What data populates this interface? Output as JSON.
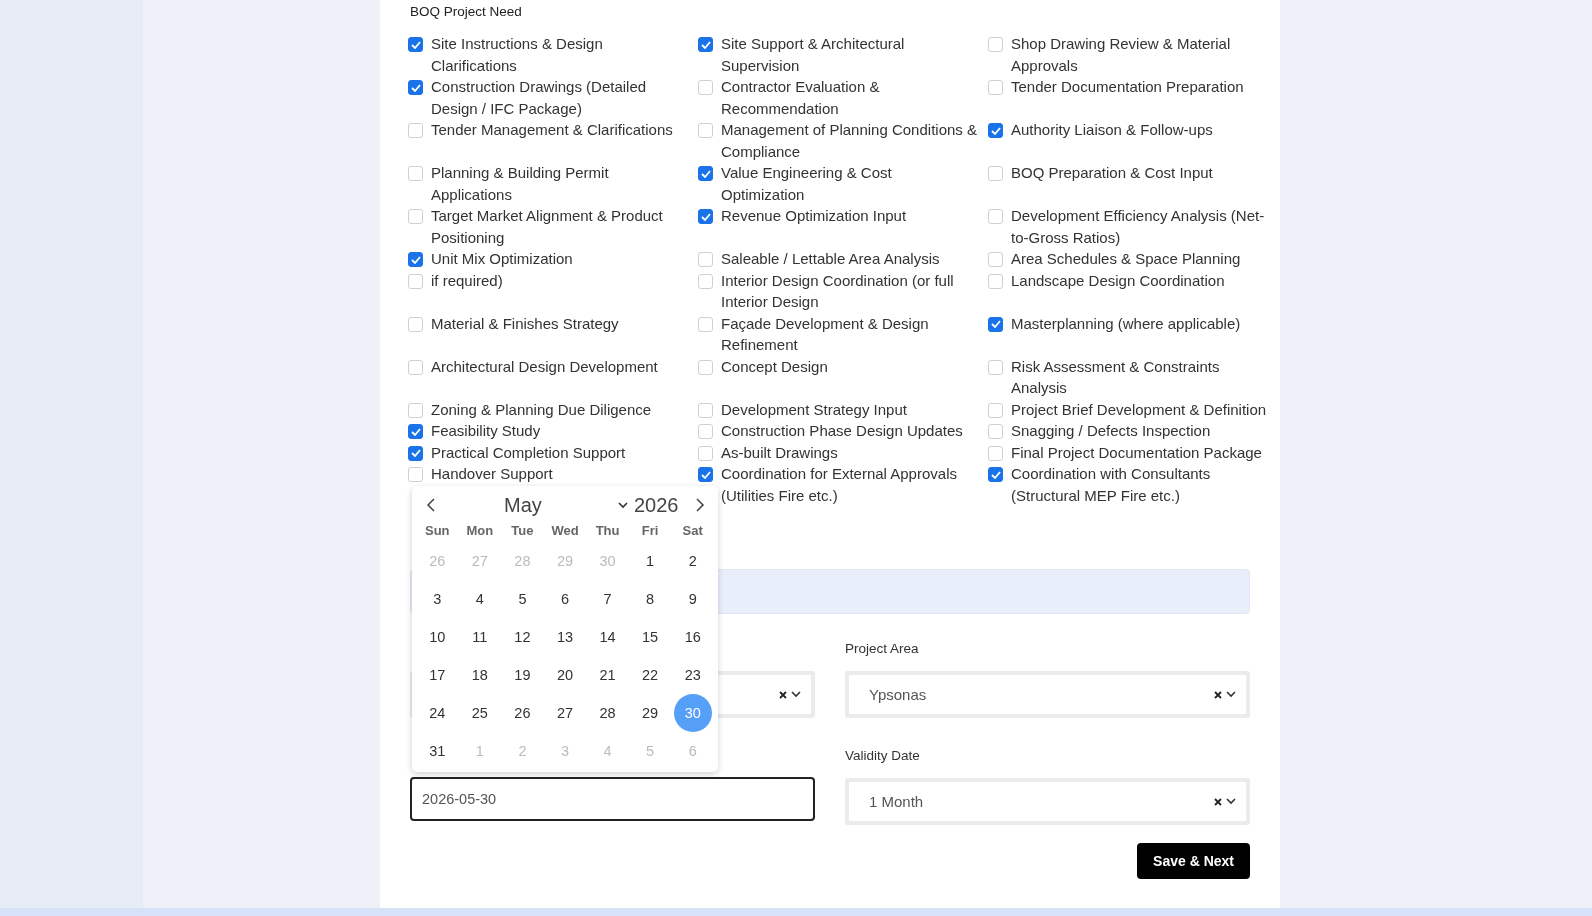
{
  "section": {
    "title": "BOQ Project Need",
    "options": [
      {
        "label": "Site Instructions & Design Clarifications",
        "checked": true
      },
      {
        "label": "Site Support & Architectural Supervision",
        "checked": true
      },
      {
        "label": "Shop Drawing Review & Material Approvals",
        "checked": false
      },
      {
        "label": "Construction Drawings (Detailed Design / IFC Package)",
        "checked": true
      },
      {
        "label": "Contractor Evaluation & Recommendation",
        "checked": false
      },
      {
        "label": "Tender Documentation Preparation",
        "checked": false
      },
      {
        "label": "Tender Management & Clarifications",
        "checked": false
      },
      {
        "label": "Management of Planning Conditions & Compliance",
        "checked": false
      },
      {
        "label": "Authority Liaison & Follow-ups",
        "checked": true
      },
      {
        "label": "Planning & Building Permit Applications",
        "checked": false
      },
      {
        "label": "Value Engineering & Cost Optimization",
        "checked": true
      },
      {
        "label": "BOQ Preparation & Cost Input",
        "checked": false
      },
      {
        "label": "Target Market Alignment & Product Positioning",
        "checked": false
      },
      {
        "label": "Revenue Optimization Input",
        "checked": true
      },
      {
        "label": "Development Efficiency Analysis (Net-to-Gross Ratios)",
        "checked": false
      },
      {
        "label": "Unit Mix Optimization",
        "checked": true
      },
      {
        "label": "Saleable / Lettable Area Analysis",
        "checked": false
      },
      {
        "label": "Area Schedules & Space Planning",
        "checked": false
      },
      {
        "label": "if required)",
        "checked": false
      },
      {
        "label": "Interior Design Coordination (or full Interior Design",
        "checked": false
      },
      {
        "label": "Landscape Design Coordination",
        "checked": false
      },
      {
        "label": "Material & Finishes Strategy",
        "checked": false
      },
      {
        "label": "Façade Development & Design Refinement",
        "checked": false
      },
      {
        "label": "Masterplanning (where applicable)",
        "checked": true
      },
      {
        "label": "Architectural Design Development",
        "checked": false
      },
      {
        "label": "Concept Design",
        "checked": false
      },
      {
        "label": "Risk Assessment & Constraints Analysis",
        "checked": false
      },
      {
        "label": "Zoning & Planning Due Diligence",
        "checked": false
      },
      {
        "label": "Development Strategy Input",
        "checked": false
      },
      {
        "label": "Project Brief Development & Definition",
        "checked": false
      },
      {
        "label": "Feasibility Study",
        "checked": true
      },
      {
        "label": "Construction Phase Design Updates",
        "checked": false
      },
      {
        "label": "Snagging / Defects Inspection",
        "checked": false
      },
      {
        "label": "Practical Completion Support",
        "checked": true
      },
      {
        "label": "As-built Drawings",
        "checked": false
      },
      {
        "label": "Final Project Documentation Package",
        "checked": false
      },
      {
        "label": "Handover Support",
        "checked": false
      },
      {
        "label": "Coordination for External Approvals (Utilities Fire etc.)",
        "checked": true
      },
      {
        "label": "Coordination with Consultants (Structural MEP Fire etc.)",
        "checked": true
      }
    ]
  },
  "fields": [
    {
      "kind": "select"
    },
    {
      "kind": "select",
      "label": "Project Area",
      "value": "Ypsonas"
    },
    {
      "kind": "date",
      "value": "2026-05-30",
      "focused": true
    },
    {
      "kind": "select",
      "label": "Validity Date",
      "value": "1 Month"
    }
  ],
  "datepicker": {
    "month": "May",
    "year": "2026",
    "weekdays": [
      "Sun",
      "Mon",
      "Tue",
      "Wed",
      "Thu",
      "Fri",
      "Sat"
    ],
    "days": [
      {
        "label": "26",
        "muted": true,
        "selected": false
      },
      {
        "label": "27",
        "muted": true,
        "selected": false
      },
      {
        "label": "28",
        "muted": true,
        "selected": false
      },
      {
        "label": "29",
        "muted": true,
        "selected": false
      },
      {
        "label": "30",
        "muted": true,
        "selected": false
      },
      {
        "label": "1",
        "muted": false,
        "selected": false
      },
      {
        "label": "2",
        "muted": false,
        "selected": false
      },
      {
        "label": "3",
        "muted": false,
        "selected": false
      },
      {
        "label": "4",
        "muted": false,
        "selected": false
      },
      {
        "label": "5",
        "muted": false,
        "selected": false
      },
      {
        "label": "6",
        "muted": false,
        "selected": false
      },
      {
        "label": "7",
        "muted": false,
        "selected": false
      },
      {
        "label": "8",
        "muted": false,
        "selected": false
      },
      {
        "label": "9",
        "muted": false,
        "selected": false
      },
      {
        "label": "10",
        "muted": false,
        "selected": false
      },
      {
        "label": "11",
        "muted": false,
        "selected": false
      },
      {
        "label": "12",
        "muted": false,
        "selected": false
      },
      {
        "label": "13",
        "muted": false,
        "selected": false
      },
      {
        "label": "14",
        "muted": false,
        "selected": false
      },
      {
        "label": "15",
        "muted": false,
        "selected": false
      },
      {
        "label": "16",
        "muted": false,
        "selected": false
      },
      {
        "label": "17",
        "muted": false,
        "selected": false
      },
      {
        "label": "18",
        "muted": false,
        "selected": false
      },
      {
        "label": "19",
        "muted": false,
        "selected": false
      },
      {
        "label": "20",
        "muted": false,
        "selected": false
      },
      {
        "label": "21",
        "muted": false,
        "selected": false
      },
      {
        "label": "22",
        "muted": false,
        "selected": false
      },
      {
        "label": "23",
        "muted": false,
        "selected": false
      },
      {
        "label": "24",
        "muted": false,
        "selected": false
      },
      {
        "label": "25",
        "muted": false,
        "selected": false
      },
      {
        "label": "26",
        "muted": false,
        "selected": false
      },
      {
        "label": "27",
        "muted": false,
        "selected": false
      },
      {
        "label": "28",
        "muted": false,
        "selected": false
      },
      {
        "label": "29",
        "muted": false,
        "selected": false
      },
      {
        "label": "30",
        "muted": false,
        "selected": true
      },
      {
        "label": "31",
        "muted": false,
        "selected": false
      },
      {
        "label": "1",
        "muted": true,
        "selected": false
      },
      {
        "label": "2",
        "muted": true,
        "selected": false
      },
      {
        "label": "3",
        "muted": true,
        "selected": false
      },
      {
        "label": "4",
        "muted": true,
        "selected": false
      },
      {
        "label": "5",
        "muted": true,
        "selected": false
      },
      {
        "label": "6",
        "muted": true,
        "selected": false
      }
    ]
  },
  "buttons": [
    {
      "label": "Save & Next"
    }
  ]
}
